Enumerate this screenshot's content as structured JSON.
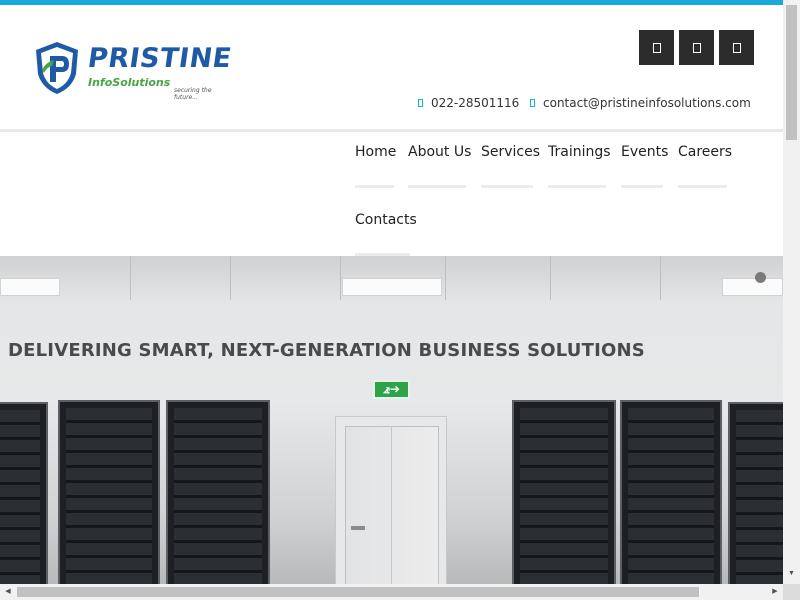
{
  "brand": {
    "name": "PRISTINE",
    "sub": "InfoSolutions",
    "tagline": "securing the future...",
    "colors": {
      "primary": "#1f5aa6",
      "secondary": "#45a646",
      "accent": "#19a9dd"
    }
  },
  "social": [
    {
      "icon": "social-icon-1",
      "label": ""
    },
    {
      "icon": "social-icon-2",
      "label": ""
    },
    {
      "icon": "social-icon-3",
      "label": ""
    }
  ],
  "contact": {
    "phone": "022-28501116",
    "email": "contact@pristineinfosolutions.com"
  },
  "nav": {
    "items": [
      {
        "label": "Home"
      },
      {
        "label": "About Us"
      },
      {
        "label": "Services"
      },
      {
        "label": "Trainings"
      },
      {
        "label": "Events"
      },
      {
        "label": "Careers"
      },
      {
        "label": "Contacts"
      }
    ]
  },
  "hero": {
    "heading": "DELIVERING SMART, NEXT-GENERATION BUSINESS SOLUTIONS",
    "exit_sign": "⦨➔"
  },
  "scroll": {
    "up": "▲",
    "down": "▼",
    "left": "◀",
    "right": "▶"
  }
}
